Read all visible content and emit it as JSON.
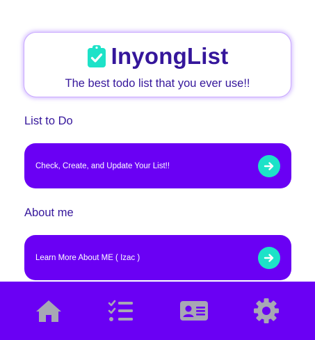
{
  "app": {
    "title": "InyongList",
    "tagline": "The best todo list that you ever use!!"
  },
  "sections": [
    {
      "title": "List to Do",
      "action_label": "Check, Create, and Update Your List!!"
    },
    {
      "title": "About me",
      "action_label": "Learn More About ME ( Izac )"
    }
  ],
  "bottom_nav": [
    {
      "icon": "home-icon"
    },
    {
      "icon": "task-list-icon"
    },
    {
      "icon": "id-card-icon"
    },
    {
      "icon": "settings-gear-icon"
    }
  ],
  "colors": {
    "primary": "#6a00f4",
    "accent": "#1de2c8",
    "title_text": "#35169b",
    "nav_icon": "#a7a7b4",
    "card_border": "#c9a8ff"
  }
}
